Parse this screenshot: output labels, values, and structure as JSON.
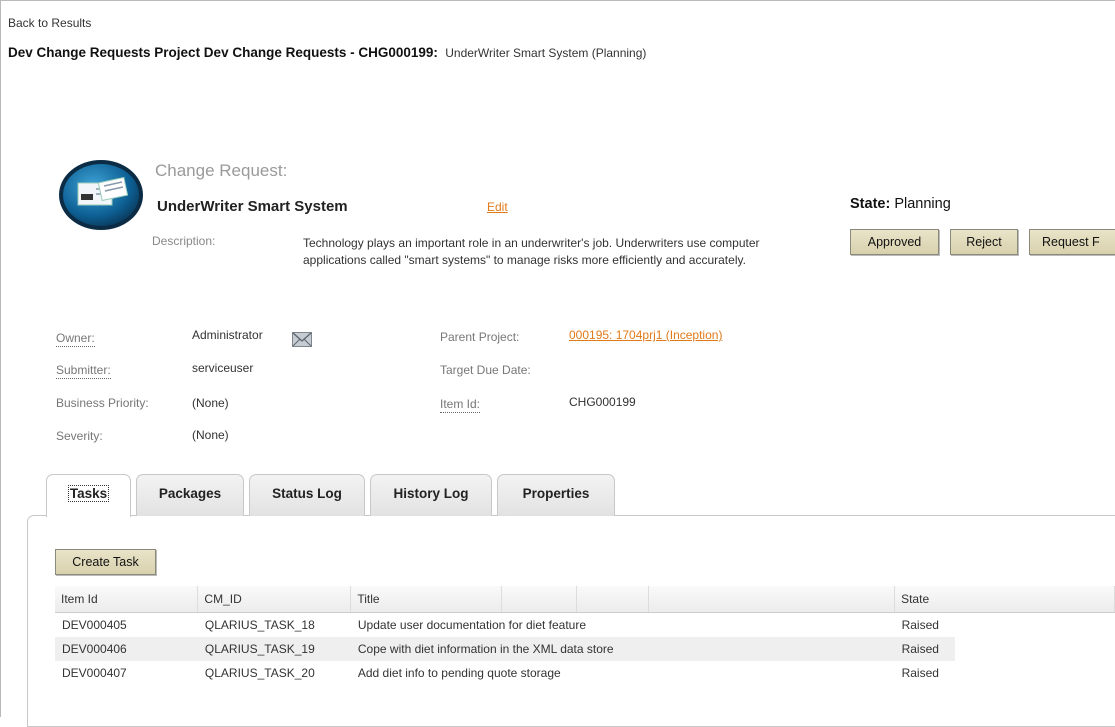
{
  "nav": {
    "back_label": "Back to Results"
  },
  "header": {
    "title_bold": "Dev Change Requests Project Dev Change Requests - CHG000199:",
    "title_plain": "UnderWriter Smart System (Planning)"
  },
  "record": {
    "type_label": "Change Request:",
    "title": "UnderWriter Smart System",
    "edit_label": "Edit",
    "description_label": "Description:",
    "description": "Technology plays an important role in an underwriter's job. Underwriters use computer applications called \"smart systems\" to manage risks more efficiently and accurately.",
    "icon": "change-request-icon"
  },
  "state": {
    "label": "State:",
    "value": "Planning",
    "actions": [
      "Approved",
      "Reject",
      "Request F"
    ]
  },
  "fields": {
    "owner_label": "Owner:",
    "owner": "Administrator",
    "submitter_label": "Submitter:",
    "submitter": "serviceuser",
    "business_priority_label": "Business Priority:",
    "business_priority": "(None)",
    "severity_label": "Severity:",
    "severity": "(None)",
    "parent_project_label": "Parent Project:",
    "parent_project": "000195: 1704prj1 (Inception)",
    "target_due_date_label": "Target Due Date:",
    "item_id_label": "Item Id:",
    "item_id": "CHG000199"
  },
  "tabs": [
    "Tasks",
    "Packages",
    "Status Log",
    "History Log",
    "Properties"
  ],
  "tasks": {
    "create_label": "Create Task",
    "columns": [
      "Item Id",
      "CM_ID",
      "Title",
      "",
      "",
      "",
      "State"
    ],
    "rows": [
      {
        "item_id": "DEV000405",
        "cm_id": "QLARIUS_TASK_18",
        "title": "Update user documentation for diet feature",
        "state": "Raised"
      },
      {
        "item_id": "DEV000406",
        "cm_id": "QLARIUS_TASK_19",
        "title": "Cope with diet information in the XML data store",
        "state": "Raised"
      },
      {
        "item_id": "DEV000407",
        "cm_id": "QLARIUS_TASK_20",
        "title": "Add diet info to pending quote storage",
        "state": "Raised"
      }
    ]
  },
  "colors": {
    "link": "#e07a1a",
    "button": "#ddd5b3"
  }
}
